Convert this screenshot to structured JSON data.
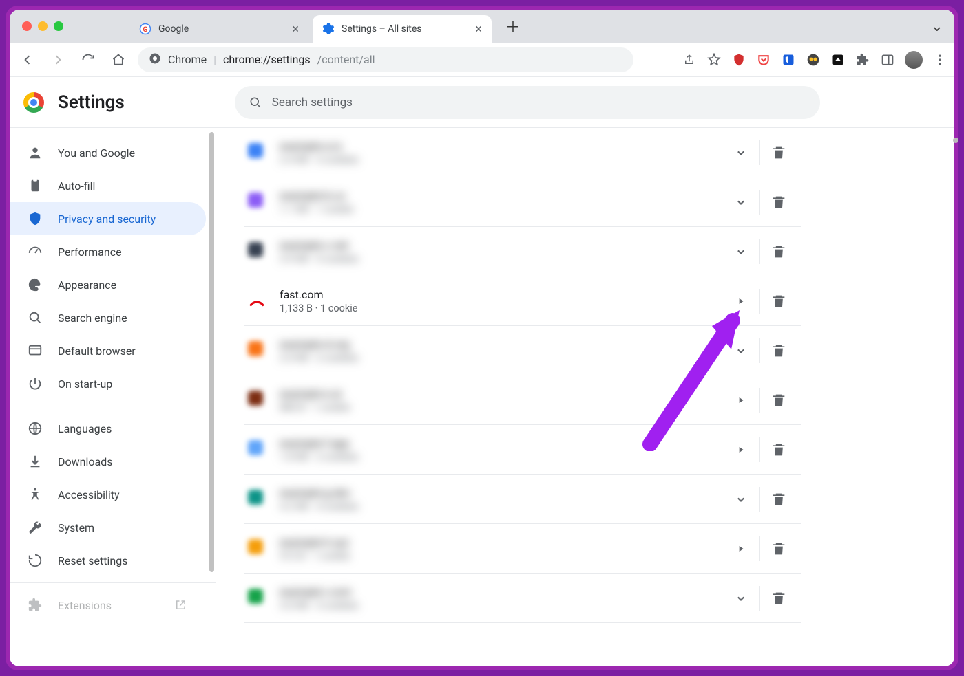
{
  "colors": {
    "accent": "#1967d2",
    "annotation": "#a020f0"
  },
  "titlebar": {
    "tabs": [
      {
        "label": "Google",
        "favicon": "google",
        "active": false
      },
      {
        "label": "Settings – All sites",
        "favicon": "gear-blue",
        "active": true
      }
    ]
  },
  "urlbar": {
    "label": "Chrome",
    "url_prefix": "chrome://settings",
    "url_suffix": "/content/all"
  },
  "header": {
    "title": "Settings",
    "search_placeholder": "Search settings"
  },
  "sidebar": {
    "items": [
      {
        "icon": "person",
        "label": "You and Google"
      },
      {
        "icon": "clipboard",
        "label": "Auto-fill"
      },
      {
        "icon": "shield",
        "label": "Privacy and security",
        "active": true
      },
      {
        "icon": "gauge",
        "label": "Performance"
      },
      {
        "icon": "palette",
        "label": "Appearance"
      },
      {
        "icon": "search",
        "label": "Search engine"
      },
      {
        "icon": "browser",
        "label": "Default browser"
      },
      {
        "icon": "power",
        "label": "On start-up"
      }
    ],
    "items2": [
      {
        "icon": "globe",
        "label": "Languages"
      },
      {
        "icon": "download",
        "label": "Downloads"
      },
      {
        "icon": "accessibility",
        "label": "Accessibility"
      },
      {
        "icon": "wrench",
        "label": "System"
      },
      {
        "icon": "reset",
        "label": "Reset settings"
      }
    ],
    "extensions_label": "Extensions"
  },
  "sites": [
    {
      "name": "example-a.io",
      "meta": "2.4 KB · 3 cookies",
      "icon": "#3b82f6",
      "chevron": "down",
      "blurred": true
    },
    {
      "name": "example-b.co",
      "meta": "1.1 KB · 1 cookie",
      "icon": "#8b5cf6",
      "chevron": "down",
      "blurred": true
    },
    {
      "name": "example-c.net",
      "meta": "3.9 KB · 5 cookies",
      "icon": "#374151",
      "chevron": "down",
      "blurred": true
    },
    {
      "name": "fast.com",
      "meta": "1,133 B · 1 cookie",
      "icon": "fast",
      "chevron": "right",
      "blurred": false
    },
    {
      "name": "example-d.org",
      "meta": "2.0 KB · 2 cookies",
      "icon": "#f97316",
      "chevron": "down",
      "blurred": true
    },
    {
      "name": "example-e.ai",
      "meta": "880 B · 1 cookie",
      "icon": "#7c2d12",
      "chevron": "right",
      "blurred": true
    },
    {
      "name": "example-f.app",
      "meta": "1.8 KB · 2 cookies",
      "icon": "#60a5fa",
      "chevron": "right",
      "blurred": true
    },
    {
      "name": "example-g.dev",
      "meta": "4.2 KB · 4 cookies",
      "icon": "#0d9488",
      "chevron": "down",
      "blurred": true
    },
    {
      "name": "example-h.xyz",
      "meta": "512 B · 1 cookie",
      "icon": "#f59e0b",
      "chevron": "right",
      "blurred": true
    },
    {
      "name": "example-i.com",
      "meta": "3.0 KB · 3 cookies",
      "icon": "#16a34a",
      "chevron": "down",
      "blurred": true
    }
  ]
}
